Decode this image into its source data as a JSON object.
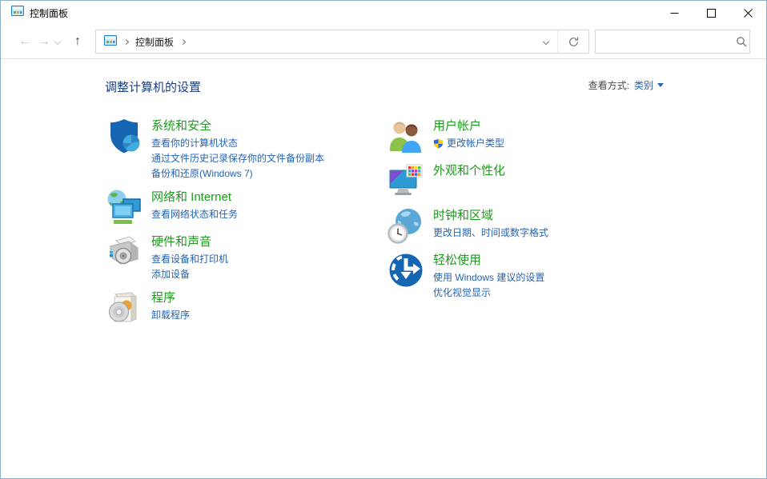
{
  "window": {
    "title": "控制面板"
  },
  "navbar": {
    "breadcrumb": {
      "root_label": "控制面板"
    },
    "search": {
      "value": ""
    }
  },
  "header": {
    "title": "调整计算机的设置",
    "view_by_label": "查看方式:",
    "view_by_value": "类别"
  },
  "columns": {
    "left": [
      {
        "icon": "security-shield-icon",
        "title": "系统和安全",
        "tasks": [
          "查看你的计算机状态",
          "通过文件历史记录保存你的文件备份副本",
          "备份和还原(Windows 7)"
        ]
      },
      {
        "icon": "network-icon",
        "title": "网络和 Internet",
        "tasks": [
          "查看网络状态和任务"
        ]
      },
      {
        "icon": "hardware-sound-icon",
        "title": "硬件和声音",
        "tasks": [
          "查看设备和打印机",
          "添加设备"
        ]
      },
      {
        "icon": "programs-icon",
        "title": "程序",
        "tasks": [
          "卸载程序"
        ]
      }
    ],
    "right": [
      {
        "icon": "user-accounts-icon",
        "title": "用户帐户",
        "tasks": [
          "更改帐户类型"
        ],
        "task_has_uac_shield": true
      },
      {
        "icon": "appearance-icon",
        "title": "外观和个性化",
        "tasks": []
      },
      {
        "icon": "clock-region-icon",
        "title": "时钟和区域",
        "tasks": [
          "更改日期、时间或数字格式"
        ]
      },
      {
        "icon": "ease-of-access-icon",
        "title": "轻松使用",
        "tasks": [
          "使用 Windows 建议的设置",
          "优化视觉显示"
        ]
      }
    ]
  },
  "colors": {
    "category_green": "#1c9b1c",
    "link_blue": "#2464b4",
    "header_navy": "#1c3e7c",
    "view_label_gray": "#4a4a4a"
  }
}
